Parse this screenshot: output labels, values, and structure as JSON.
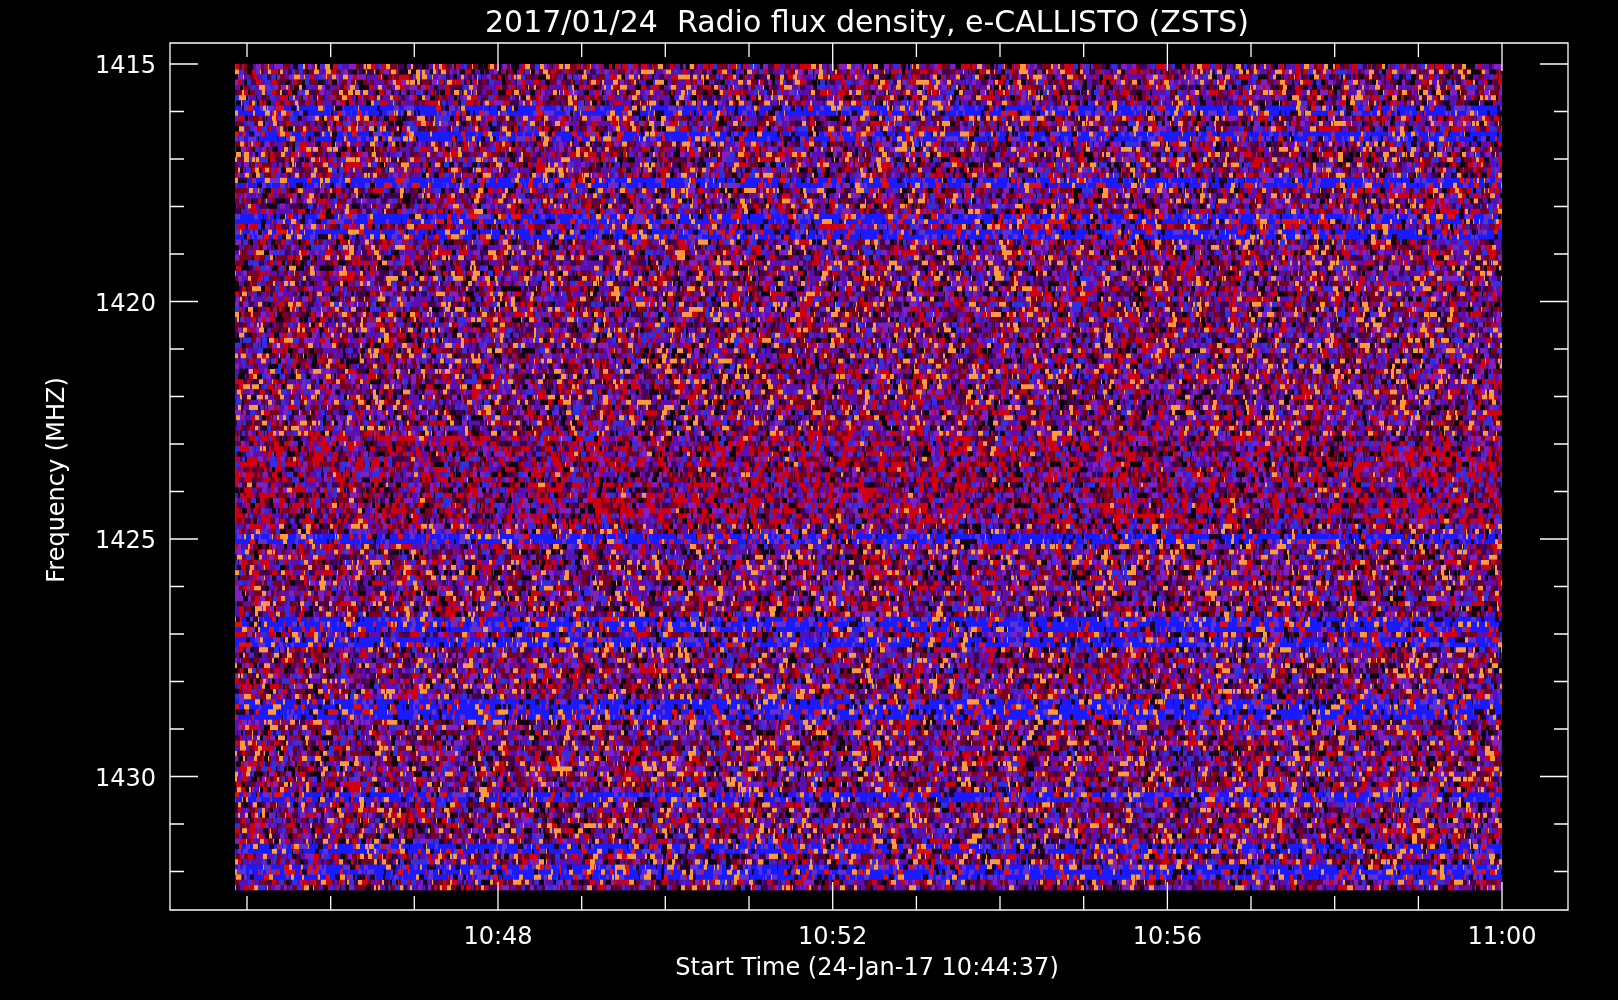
{
  "title": "2017/01/24  Radio flux density, e-CALLISTO (ZSTS)",
  "y_axis": {
    "label": "Frequency (MHZ)",
    "ticks": [
      "1415",
      "1420",
      "1425",
      "1430"
    ]
  },
  "x_axis": {
    "label": "Start Time (24-Jan-17 10:44:37)",
    "ticks": [
      "10:48",
      "10:52",
      "10:56",
      "11:00"
    ]
  }
}
